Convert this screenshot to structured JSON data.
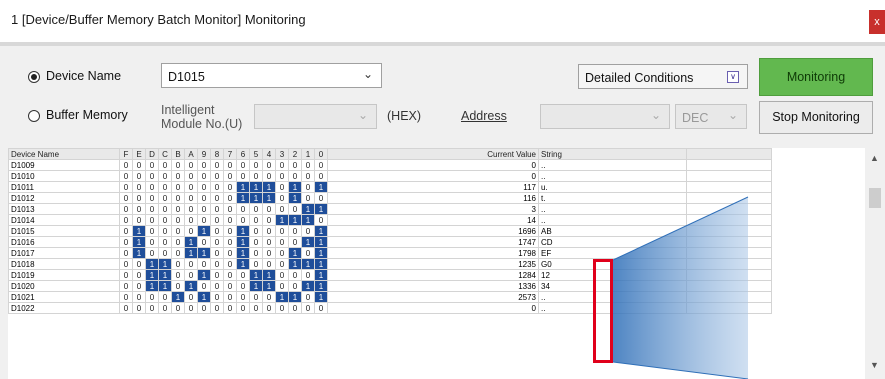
{
  "window": {
    "title": "1 [Device/Buffer Memory Batch Monitor] Monitoring",
    "close_label": "x"
  },
  "controls": {
    "device_name_radio": "Device Name",
    "device_name_value": "D1015",
    "buffer_memory_radio": "Buffer Memory",
    "intelligent_module_label_line1": "Intelligent",
    "intelligent_module_label_line2": "Module No.(U)",
    "hex_label": "(HEX)",
    "address_label": "Address",
    "dec_value": "DEC",
    "detailed_conditions": "Detailed Conditions",
    "monitoring_button": "Monitoring",
    "stop_monitoring_button": "Stop Monitoring"
  },
  "colors": {
    "bit_on": "#1f4e9a",
    "monitor_button": "#62b84f",
    "highlight": "#e0001b"
  },
  "table": {
    "headers": {
      "device": "Device Name",
      "bits": [
        "F",
        "E",
        "D",
        "C",
        "B",
        "A",
        "9",
        "8",
        "7",
        "6",
        "5",
        "4",
        "3",
        "2",
        "1",
        "0"
      ],
      "current_value": "Current Value",
      "string": "String"
    },
    "rows": [
      {
        "name": "D1009",
        "bits": [
          "0",
          "0",
          "0",
          "0",
          "0",
          "0",
          "0",
          "0",
          "0",
          "0",
          "0",
          "0",
          "0",
          "0",
          "0",
          "0"
        ],
        "value": "0",
        "string": ".."
      },
      {
        "name": "D1010",
        "bits": [
          "0",
          "0",
          "0",
          "0",
          "0",
          "0",
          "0",
          "0",
          "0",
          "0",
          "0",
          "0",
          "0",
          "0",
          "0",
          "0"
        ],
        "value": "0",
        "string": ".."
      },
      {
        "name": "D1011",
        "bits": [
          "0",
          "0",
          "0",
          "0",
          "0",
          "0",
          "0",
          "0",
          "0",
          "1",
          "1",
          "1",
          "0",
          "1",
          "0",
          "1"
        ],
        "value": "117",
        "string": "u."
      },
      {
        "name": "D1012",
        "bits": [
          "0",
          "0",
          "0",
          "0",
          "0",
          "0",
          "0",
          "0",
          "0",
          "1",
          "1",
          "1",
          "0",
          "1",
          "0",
          "0"
        ],
        "value": "116",
        "string": "t."
      },
      {
        "name": "D1013",
        "bits": [
          "0",
          "0",
          "0",
          "0",
          "0",
          "0",
          "0",
          "0",
          "0",
          "0",
          "0",
          "0",
          "0",
          "0",
          "1",
          "1"
        ],
        "value": "3",
        "string": ".."
      },
      {
        "name": "D1014",
        "bits": [
          "0",
          "0",
          "0",
          "0",
          "0",
          "0",
          "0",
          "0",
          "0",
          "0",
          "0",
          "0",
          "1",
          "1",
          "1",
          "0"
        ],
        "value": "14",
        "string": ".."
      },
      {
        "name": "D1015",
        "bits": [
          "0",
          "1",
          "0",
          "0",
          "0",
          "0",
          "1",
          "0",
          "0",
          "1",
          "0",
          "0",
          "0",
          "0",
          "0",
          "1"
        ],
        "value": "1696",
        "string": "AB"
      },
      {
        "name": "D1016",
        "bits": [
          "0",
          "1",
          "0",
          "0",
          "0",
          "1",
          "0",
          "0",
          "0",
          "1",
          "0",
          "0",
          "0",
          "0",
          "1",
          "1"
        ],
        "value": "1747",
        "string": "CD"
      },
      {
        "name": "D1017",
        "bits": [
          "0",
          "1",
          "0",
          "0",
          "0",
          "1",
          "1",
          "0",
          "0",
          "1",
          "0",
          "0",
          "0",
          "1",
          "0",
          "1"
        ],
        "value": "1798",
        "string": "EF"
      },
      {
        "name": "D1018",
        "bits": [
          "0",
          "0",
          "1",
          "1",
          "0",
          "0",
          "0",
          "0",
          "0",
          "1",
          "0",
          "0",
          "0",
          "1",
          "1",
          "1"
        ],
        "value": "1235",
        "string": "G0"
      },
      {
        "name": "D1019",
        "bits": [
          "0",
          "0",
          "1",
          "1",
          "0",
          "0",
          "1",
          "0",
          "0",
          "0",
          "1",
          "1",
          "0",
          "0",
          "0",
          "1"
        ],
        "value": "1284",
        "string": "12"
      },
      {
        "name": "D1020",
        "bits": [
          "0",
          "0",
          "1",
          "1",
          "0",
          "1",
          "0",
          "0",
          "0",
          "0",
          "1",
          "1",
          "0",
          "0",
          "1",
          "1"
        ],
        "value": "1336",
        "string": "34"
      },
      {
        "name": "D1021",
        "bits": [
          "0",
          "0",
          "0",
          "0",
          "1",
          "0",
          "1",
          "0",
          "0",
          "0",
          "0",
          "0",
          "1",
          "1",
          "0",
          "1"
        ],
        "value": "2573",
        "string": ".."
      },
      {
        "name": "D1022",
        "bits": [
          "0",
          "0",
          "0",
          "0",
          "0",
          "0",
          "0",
          "0",
          "0",
          "0",
          "0",
          "0",
          "0",
          "0",
          "0",
          "0"
        ],
        "value": "0",
        "string": ".."
      }
    ]
  }
}
